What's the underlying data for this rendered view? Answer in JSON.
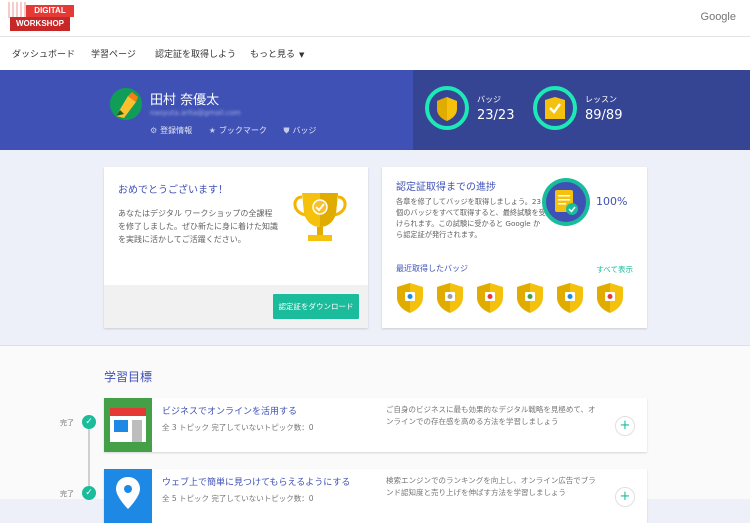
{
  "brand": {
    "logo_line1": "DIGITAL",
    "logo_line2": "WORKSHOP",
    "google": "Google"
  },
  "nav": {
    "items": [
      "ダッシュボード",
      "学習ページ",
      "認定証を取得しよう",
      "もっと見る"
    ],
    "caret": "▼"
  },
  "profile": {
    "name": "田村 奈優太",
    "email": "naoyuta.arita@gmail.com",
    "links": [
      {
        "icon": "gear-icon",
        "glyph": "⚙",
        "label": "登録情報"
      },
      {
        "icon": "star-icon",
        "glyph": "★",
        "label": "ブックマーク"
      },
      {
        "icon": "shield-icon",
        "glyph": "⛊",
        "label": "バッジ"
      }
    ]
  },
  "stats": [
    {
      "label": "バッジ",
      "value": "23/23"
    },
    {
      "label": "レッスン",
      "value": "89/89"
    }
  ],
  "congrats": {
    "title": "おめでとうございます！",
    "body": "あなたはデジタル ワークショップの全課程を修了しました。ぜひ新たに身に着けた知識を実践に活かしてご活躍ください。",
    "button": "認定証をダウンロード"
  },
  "progress": {
    "title": "認定証取得までの進捗",
    "body": "各章を修了してバッジを取得しましょう。23 個のバッジをすべて取得すると、最終試験を受けられます。この試験に受かると Google から認定証が発行されます。",
    "percent": "100%",
    "recent_label": "最近取得したバッジ",
    "see_all": "すべて表示",
    "badge_count": 6
  },
  "goals": {
    "title": "学習目標",
    "done_label": "完了",
    "items": [
      {
        "name": "ビジネスでオンラインを活用する",
        "meta": "全 3 トピック 完了していないトピック数：0",
        "desc": "ご自身のビジネスに最も効果的なデジタル戦略を見極めて、オンラインでの存在感を高める方法を学習しましょう"
      },
      {
        "name": "ウェブ上で簡単に見つけてもらえるようにする",
        "meta": "全 5 トピック 完了していないトピック数：0",
        "desc": "検索エンジンでのランキングを向上し、オンライン広告でブランド認知度と売り上げを伸ばす方法を学習しましょう"
      }
    ]
  },
  "colors": {
    "primary": "#3f51b5",
    "accent": "#1abc9c",
    "gold": "#f4c20d"
  }
}
